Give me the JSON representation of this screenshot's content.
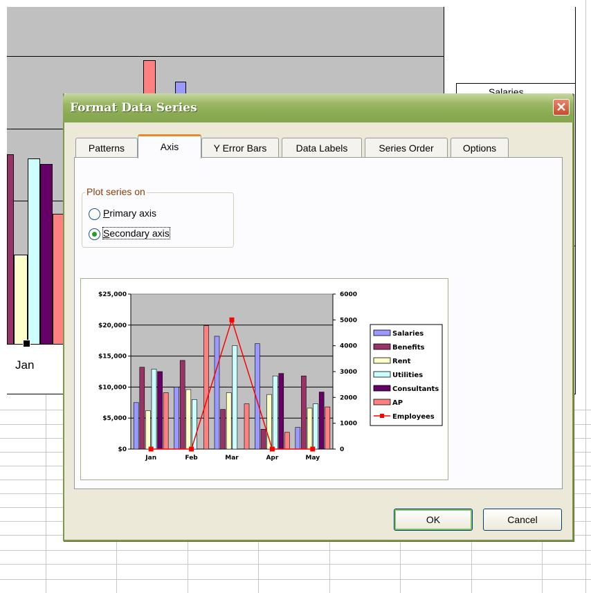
{
  "background": {
    "category_label": "Jan",
    "legend_text_partial": "Salaries"
  },
  "dialog": {
    "title": "Format Data Series",
    "close_label": "✕",
    "tabs": [
      {
        "label": "Patterns",
        "active": false
      },
      {
        "label": "Axis",
        "active": true
      },
      {
        "label": "Y Error Bars",
        "active": false
      },
      {
        "label": "Data Labels",
        "active": false
      },
      {
        "label": "Series Order",
        "active": false
      },
      {
        "label": "Options",
        "active": false
      }
    ],
    "plot_series_group": {
      "label": "Plot series on",
      "primary": {
        "label_key": "P",
        "label_rest": "rimary axis",
        "selected": false
      },
      "secondary": {
        "label_key": "S",
        "label_rest": "econdary axis",
        "selected": true
      }
    },
    "ok_label": "OK",
    "cancel_label": "Cancel"
  },
  "chart_data": {
    "type": "bar",
    "categories": [
      "Jan",
      "Feb",
      "Mar",
      "Apr",
      "May"
    ],
    "series": [
      {
        "name": "Salaries",
        "color": "#9999ff",
        "values": [
          7500,
          10000,
          18200,
          17000,
          3500
        ]
      },
      {
        "name": "Benefits",
        "color": "#993366",
        "values": [
          13200,
          14300,
          6400,
          3200,
          11800
        ]
      },
      {
        "name": "Rent",
        "color": "#ffffcc",
        "values": [
          6200,
          9600,
          9100,
          8800,
          6600
        ]
      },
      {
        "name": "Utilities",
        "color": "#ccffff",
        "values": [
          12900,
          8000,
          16700,
          11800,
          7300
        ]
      },
      {
        "name": "Consultants",
        "color": "#660066",
        "values": [
          12500,
          0,
          0,
          12200,
          9200
        ]
      },
      {
        "name": "AP",
        "color": "#ff8080",
        "values": [
          9100,
          19900,
          7300,
          2700,
          6800
        ]
      }
    ],
    "line_series": {
      "name": "Employees",
      "color": "#ff0000",
      "axis": "secondary",
      "values": [
        0,
        0,
        5000,
        0,
        0
      ]
    },
    "ylim": [
      0,
      25000
    ],
    "y_ticks": [
      "$0",
      "$5,000",
      "$10,000",
      "$15,000",
      "$20,000",
      "$25,000"
    ],
    "y2lim": [
      0,
      6000
    ],
    "y2_ticks": [
      "0",
      "1000",
      "2000",
      "3000",
      "4000",
      "5000",
      "6000"
    ],
    "grid": true,
    "legend": "right"
  }
}
